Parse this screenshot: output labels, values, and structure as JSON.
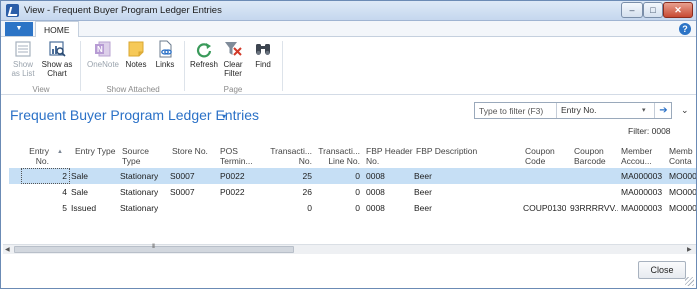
{
  "window": {
    "title": "View - Frequent Buyer Program Ledger Entries"
  },
  "window_controls": {
    "minimize": "–",
    "maximize": "□",
    "close": "✕"
  },
  "ribbon": {
    "tab_dropdown": "▼",
    "tabs": [
      "HOME"
    ],
    "help": "?",
    "groups": [
      {
        "label": "View",
        "buttons": [
          {
            "label1": "Show",
            "label2": "as List",
            "icon": "list-icon",
            "enabled": false
          },
          {
            "label1": "Show as",
            "label2": "Chart",
            "icon": "chart-icon",
            "enabled": true
          }
        ]
      },
      {
        "label": "Show Attached",
        "buttons": [
          {
            "label1": "OneNote",
            "label2": "",
            "icon": "onenote-icon",
            "enabled": false
          },
          {
            "label1": "Notes",
            "label2": "",
            "icon": "notes-icon",
            "enabled": true
          },
          {
            "label1": "Links",
            "label2": "",
            "icon": "links-icon",
            "enabled": true
          }
        ]
      },
      {
        "label": "Page",
        "buttons": [
          {
            "label1": "Refresh",
            "label2": "",
            "icon": "refresh-icon",
            "enabled": true
          },
          {
            "label1": "Clear",
            "label2": "Filter",
            "icon": "clear-filter-icon",
            "enabled": true
          },
          {
            "label1": "Find",
            "label2": "",
            "icon": "find-icon",
            "enabled": true
          }
        ]
      }
    ]
  },
  "page": {
    "title": "Frequent Buyer Program Ledger Entries",
    "title_caret": "▾",
    "filter": {
      "placeholder": "Type to filter (F3)",
      "field": "Entry No.",
      "field_caret": "▾",
      "go": "➔"
    },
    "collapse": "⌄",
    "filter_info": "Filter: 0008"
  },
  "table": {
    "sort_indicator": "▲",
    "headers": {
      "entry_no": [
        "Entry",
        "No."
      ],
      "entry_type": [
        "Entry Type",
        ""
      ],
      "source_type": [
        "Source",
        "Type"
      ],
      "store_no": [
        "Store No.",
        ""
      ],
      "pos_terminal": [
        "POS",
        "Termin..."
      ],
      "transaction_no": [
        "Transacti...",
        "No."
      ],
      "transaction_line_no": [
        "Transacti...",
        "Line No."
      ],
      "fbp_header_no": [
        "FBP Header",
        "No."
      ],
      "fbp_description": [
        "FBP Description",
        ""
      ],
      "coupon_code": [
        "Coupon",
        "Code"
      ],
      "coupon_barcode": [
        "Coupon",
        "Barcode"
      ],
      "member_account": [
        "Member",
        "Accou..."
      ],
      "member_contact": [
        "Memb",
        "Conta"
      ]
    },
    "rows": [
      {
        "entry_no": "2",
        "entry_type": "Sale",
        "source_type": "Stationary",
        "store_no": "S0007",
        "pos_terminal": "P0022",
        "transaction_no": "25",
        "transaction_line_no": "0",
        "fbp_header_no": "0008",
        "fbp_description": "Beer",
        "coupon_code": "",
        "coupon_barcode": "",
        "member_account": "MA000003",
        "member_contact": "MO000",
        "selected": true
      },
      {
        "entry_no": "4",
        "entry_type": "Sale",
        "source_type": "Stationary",
        "store_no": "S0007",
        "pos_terminal": "P0022",
        "transaction_no": "26",
        "transaction_line_no": "0",
        "fbp_header_no": "0008",
        "fbp_description": "Beer",
        "coupon_code": "",
        "coupon_barcode": "",
        "member_account": "MA000003",
        "member_contact": "MO000",
        "selected": false
      },
      {
        "entry_no": "5",
        "entry_type": "Issued",
        "source_type": "Stationary",
        "store_no": "",
        "pos_terminal": "",
        "transaction_no": "0",
        "transaction_line_no": "0",
        "fbp_header_no": "0008",
        "fbp_description": "Beer",
        "coupon_code": "COUP0130",
        "coupon_barcode": "93RRRRVV...",
        "member_account": "MA000003",
        "member_contact": "MO000",
        "selected": false
      }
    ]
  },
  "scrollbar": {
    "left": "◀",
    "right": "▶",
    "grip": "III"
  },
  "footer": {
    "close_label": "Close"
  }
}
